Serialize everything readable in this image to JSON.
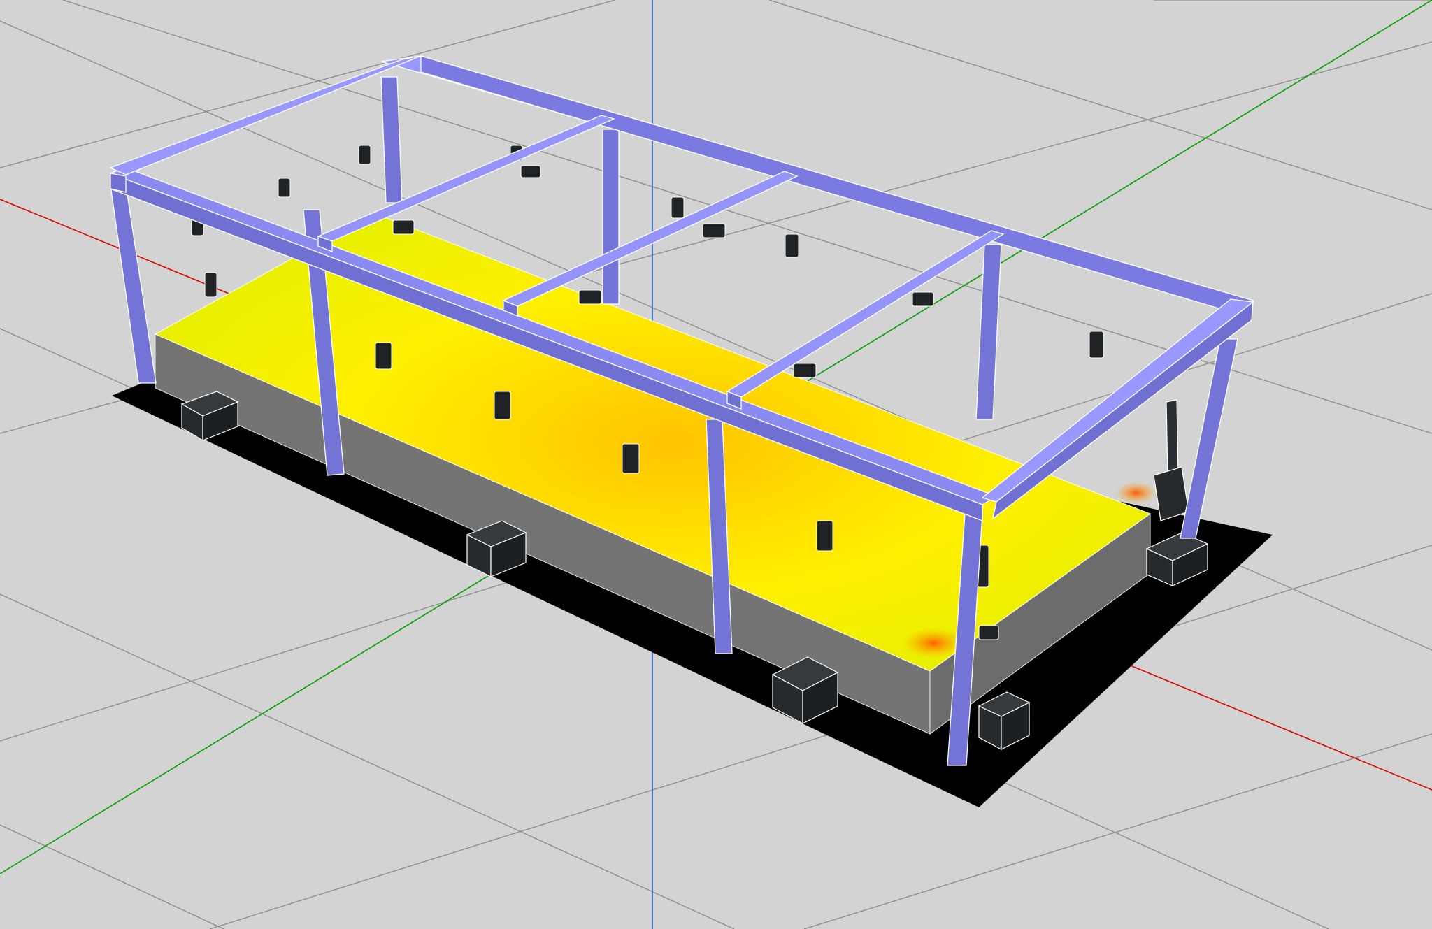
{
  "viewport": {
    "name": "3d-scene-viewport",
    "background_color": "#d3d3d3",
    "grid_color": "#8a8a8a",
    "axis_colors": {
      "x_axis": "#e00000",
      "y_axis": "#00a000",
      "z_axis": "#1e64e6"
    }
  },
  "scene": {
    "floor_slab": {
      "top_gradient": [
        "#ffc400",
        "#fff200",
        "#e6f000"
      ],
      "hotspot_color": "#ff6a00",
      "side_color": "#747474",
      "base_color": "#000000"
    },
    "frame_color": "#7474d6",
    "frame_highlight": "#9898ff",
    "support_block_color": "#2a2f33",
    "light_fixture_color": "#1f2326",
    "support_count": 6,
    "fixture_count": 20
  }
}
